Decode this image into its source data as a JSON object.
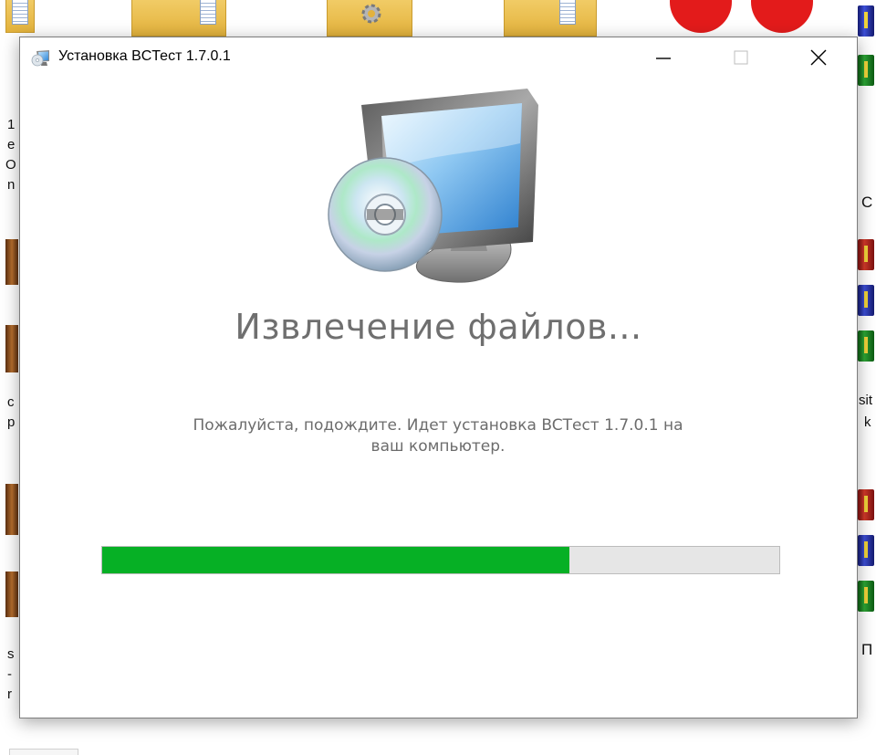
{
  "desktop": {
    "left_edge_fragments": [
      "1",
      "e",
      "O",
      "n",
      "c",
      "p",
      "s",
      "-",
      "r"
    ],
    "right_edge_fragments": [
      "C",
      "sit",
      "k",
      "П"
    ]
  },
  "window": {
    "title": "Установка BCТест 1.7.0.1",
    "icon": "installer-icon",
    "controls": {
      "minimize_icon": "minimize-icon",
      "maximize_icon": "maximize-icon",
      "close_icon": "close-icon"
    }
  },
  "installer": {
    "hero_icon": "computer-cd-icon",
    "heading": "Извлечение файлов...",
    "message_line1": "Пожалуйста, подождите. Идет установка BCТест 1.7.0.1 на",
    "message_line2": "ваш компьютер.",
    "progress_fraction": 0.69
  },
  "colors": {
    "progress_fill": "#06b025",
    "progress_track": "#e6e6e6",
    "heading_text": "#6f6f6f",
    "body_text": "#6c6c6c"
  }
}
